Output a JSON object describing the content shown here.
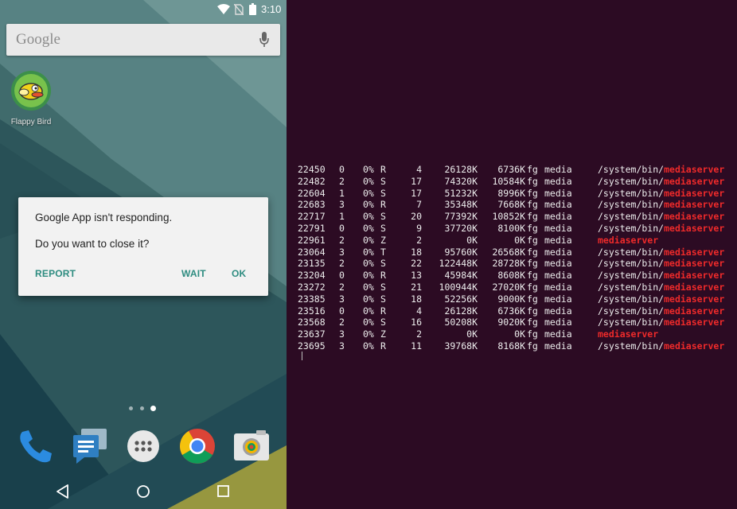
{
  "status_bar": {
    "time": "3:10"
  },
  "search": {
    "logo": "Google"
  },
  "home_apps": [
    {
      "label": "Flappy Bird"
    }
  ],
  "anr_dialog": {
    "title": "Google App isn't responding.",
    "question": "Do you want to close it?",
    "report": "REPORT",
    "wait": "WAIT",
    "ok": "OK"
  },
  "dock": [
    "phone-icon",
    "messenger-icon",
    "app-drawer-icon",
    "chrome-icon",
    "camera-icon"
  ],
  "colors": {
    "terminal_bg": "#2c0b23",
    "terminal_text": "#ededed",
    "highlight": "#ef2a2a",
    "dialog_accent": "#2e8c80"
  },
  "terminal": {
    "rows": [
      {
        "pid": "22450",
        "cpu": "0",
        "pct": "0%",
        "s": "R",
        "thr": "4",
        "vss": "26128K",
        "rss": "6736K",
        "pcy": "fg",
        "uid": "media",
        "prefix": "/system/bin/",
        "match": "mediaserver"
      },
      {
        "pid": "22482",
        "cpu": "2",
        "pct": "0%",
        "s": "S",
        "thr": "17",
        "vss": "74320K",
        "rss": "10584K",
        "pcy": "fg",
        "uid": "media",
        "prefix": "/system/bin/",
        "match": "mediaserver"
      },
      {
        "pid": "22604",
        "cpu": "1",
        "pct": "0%",
        "s": "S",
        "thr": "17",
        "vss": "51232K",
        "rss": "8996K",
        "pcy": "fg",
        "uid": "media",
        "prefix": "/system/bin/",
        "match": "mediaserver"
      },
      {
        "pid": "22683",
        "cpu": "3",
        "pct": "0%",
        "s": "R",
        "thr": "7",
        "vss": "35348K",
        "rss": "7668K",
        "pcy": "fg",
        "uid": "media",
        "prefix": "/system/bin/",
        "match": "mediaserver"
      },
      {
        "pid": "22717",
        "cpu": "1",
        "pct": "0%",
        "s": "S",
        "thr": "20",
        "vss": "77392K",
        "rss": "10852K",
        "pcy": "fg",
        "uid": "media",
        "prefix": "/system/bin/",
        "match": "mediaserver"
      },
      {
        "pid": "22791",
        "cpu": "0",
        "pct": "0%",
        "s": "S",
        "thr": "9",
        "vss": "37720K",
        "rss": "8100K",
        "pcy": "fg",
        "uid": "media",
        "prefix": "/system/bin/",
        "match": "mediaserver"
      },
      {
        "pid": "22961",
        "cpu": "2",
        "pct": "0%",
        "s": "Z",
        "thr": "2",
        "vss": "0K",
        "rss": "0K",
        "pcy": "fg",
        "uid": "media",
        "prefix": "",
        "match": "mediaserver"
      },
      {
        "pid": "23064",
        "cpu": "3",
        "pct": "0%",
        "s": "T",
        "thr": "18",
        "vss": "95760K",
        "rss": "26568K",
        "pcy": "fg",
        "uid": "media",
        "prefix": "/system/bin/",
        "match": "mediaserver"
      },
      {
        "pid": "23135",
        "cpu": "2",
        "pct": "0%",
        "s": "S",
        "thr": "22",
        "vss": "122448K",
        "rss": "28728K",
        "pcy": "fg",
        "uid": "media",
        "prefix": "/system/bin/",
        "match": "mediaserver"
      },
      {
        "pid": "23204",
        "cpu": "0",
        "pct": "0%",
        "s": "R",
        "thr": "13",
        "vss": "45984K",
        "rss": "8608K",
        "pcy": "fg",
        "uid": "media",
        "prefix": "/system/bin/",
        "match": "mediaserver"
      },
      {
        "pid": "23272",
        "cpu": "2",
        "pct": "0%",
        "s": "S",
        "thr": "21",
        "vss": "100944K",
        "rss": "27020K",
        "pcy": "fg",
        "uid": "media",
        "prefix": "/system/bin/",
        "match": "mediaserver"
      },
      {
        "pid": "23385",
        "cpu": "3",
        "pct": "0%",
        "s": "S",
        "thr": "18",
        "vss": "52256K",
        "rss": "9000K",
        "pcy": "fg",
        "uid": "media",
        "prefix": "/system/bin/",
        "match": "mediaserver"
      },
      {
        "pid": "23516",
        "cpu": "0",
        "pct": "0%",
        "s": "R",
        "thr": "4",
        "vss": "26128K",
        "rss": "6736K",
        "pcy": "fg",
        "uid": "media",
        "prefix": "/system/bin/",
        "match": "mediaserver"
      },
      {
        "pid": "23568",
        "cpu": "2",
        "pct": "0%",
        "s": "S",
        "thr": "16",
        "vss": "50208K",
        "rss": "9020K",
        "pcy": "fg",
        "uid": "media",
        "prefix": "/system/bin/",
        "match": "mediaserver"
      },
      {
        "pid": "23637",
        "cpu": "3",
        "pct": "0%",
        "s": "Z",
        "thr": "2",
        "vss": "0K",
        "rss": "0K",
        "pcy": "fg",
        "uid": "media",
        "prefix": "",
        "match": "mediaserver"
      },
      {
        "pid": "23695",
        "cpu": "3",
        "pct": "0%",
        "s": "R",
        "thr": "11",
        "vss": "39768K",
        "rss": "8168K",
        "pcy": "fg",
        "uid": "media",
        "prefix": "/system/bin/",
        "match": "mediaserver"
      }
    ]
  }
}
